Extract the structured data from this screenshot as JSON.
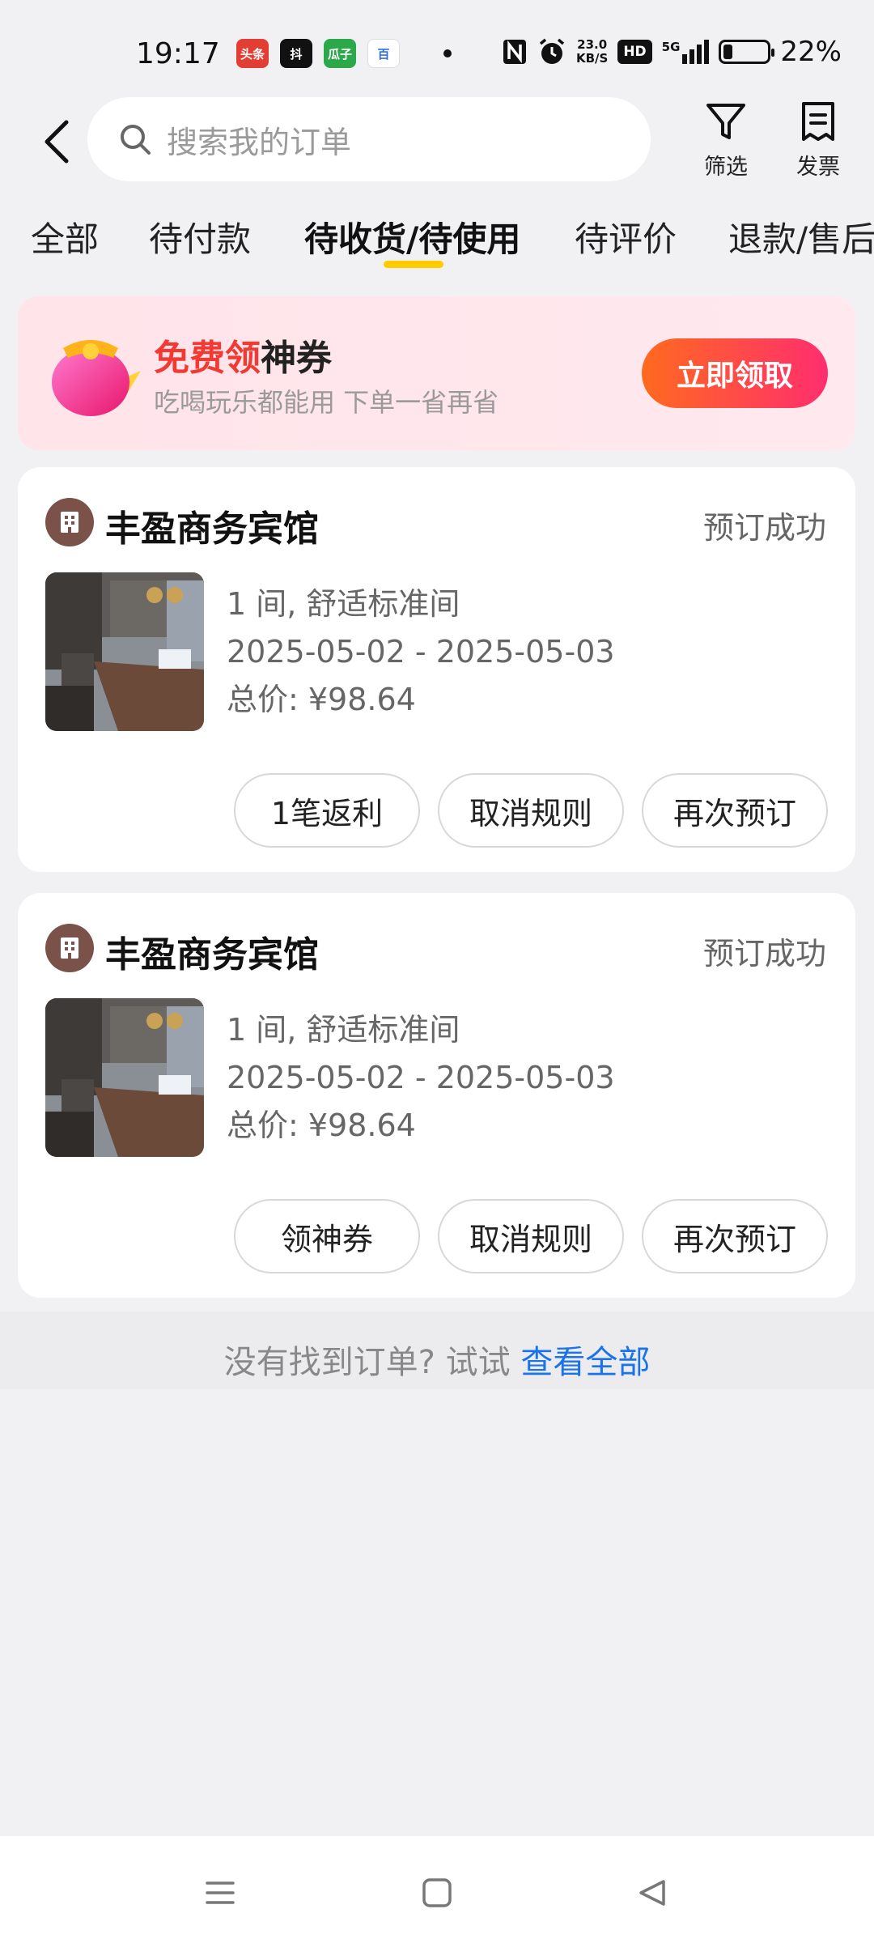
{
  "status_bar": {
    "time": "19:17",
    "apps": [
      {
        "label": "头条",
        "color": "#e33e33"
      },
      {
        "label": "抖",
        "color": "#111111"
      },
      {
        "label": "瓜子",
        "color": "#2aa84a"
      },
      {
        "label": "百",
        "color": "#2f6fe8"
      }
    ],
    "net_speed_value": "23.0",
    "net_speed_unit": "KB/S",
    "hd": "HD",
    "signal": "5G",
    "battery": "22%",
    "battery_level": 0.22
  },
  "header": {
    "search_placeholder": "搜索我的订单",
    "filter_label": "筛选",
    "invoice_label": "发票"
  },
  "tabs": [
    {
      "label": "全部",
      "active": false
    },
    {
      "label": "待付款",
      "active": false
    },
    {
      "label": "待收货/待使用",
      "active": true
    },
    {
      "label": "待评价",
      "active": false
    },
    {
      "label": "退款/售后",
      "active": false
    }
  ],
  "banner": {
    "title_highlight": "免费领",
    "title_rest": "神券",
    "subtitle": "吃喝玩乐都能用 下单一省再省",
    "button": "立即领取"
  },
  "orders": [
    {
      "hotel": "丰盈商务宾馆",
      "status": "预订成功",
      "room": "1 间, 舒适标准间",
      "dates": "2025-05-02 - 2025-05-03",
      "price": "总价: ¥98.64",
      "buttons": [
        "1笔返利",
        "取消规则",
        "再次预订"
      ]
    },
    {
      "hotel": "丰盈商务宾馆",
      "status": "预订成功",
      "room": "1 间, 舒适标准间",
      "dates": "2025-05-02 - 2025-05-03",
      "price": "总价: ¥98.64",
      "buttons": [
        "领神券",
        "取消规则",
        "再次预订"
      ]
    }
  ],
  "footer_hint": {
    "text": "没有找到订单? 试试 ",
    "link": "查看全部"
  },
  "colors": {
    "accent_yellow": "#ffcc00",
    "banner_red": "#f23a32",
    "link_blue": "#1a73e8",
    "hotel_icon": "#7b5249"
  }
}
